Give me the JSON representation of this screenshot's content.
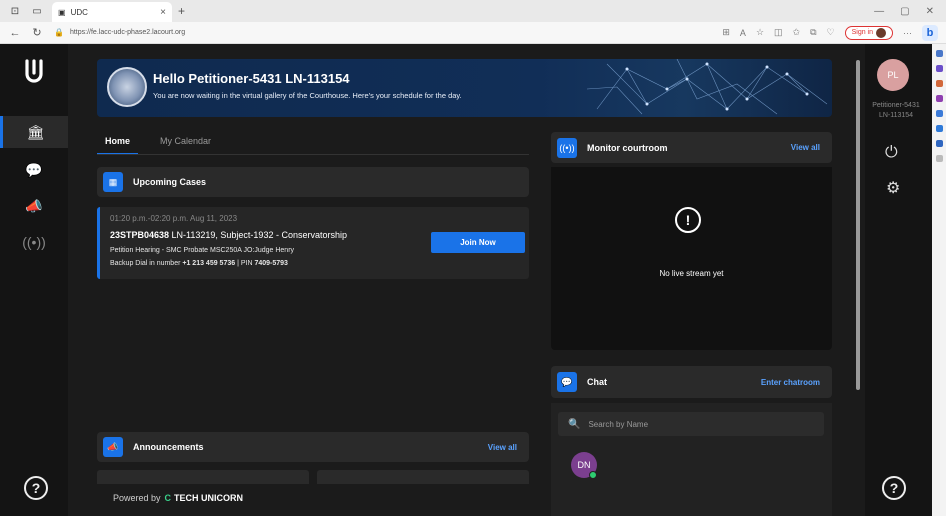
{
  "browser": {
    "tab_title": "UDC",
    "tab_close": "×",
    "new_tab": "+",
    "url": "https://fe.lacc-udc-phase2.lacourt.org",
    "signin_label": "Sign in",
    "edge_label": "b"
  },
  "sidebar": {
    "help_label": "?"
  },
  "banner": {
    "title": "Hello Petitioner-5431 LN-113154",
    "subtitle": "You are now waiting in the virtual gallery of the Courthouse. Here's your schedule for the day."
  },
  "tabs": {
    "home": "Home",
    "calendar": "My Calendar"
  },
  "upcoming": {
    "title": "Upcoming Cases",
    "case": {
      "time": "01:20 p.m.-02:20 p.m. Aug 11, 2023",
      "case_number": "23STPB04638",
      "case_rest": " LN-113219, Subject-1932 - Conservatorship",
      "line1": "Petition Hearing - SMC Probate MSC250A JO:Judge Henry",
      "backup_prefix": "Backup Dial in number ",
      "backup_number": "+1 213 459 5736",
      "pin_prefix": " | PIN ",
      "pin": "7409-5793",
      "join_label": "Join Now"
    }
  },
  "announcements": {
    "title": "Announcements",
    "view_all": "View all"
  },
  "footer": {
    "powered_by": "Powered by",
    "brand": "TECH UNICORN"
  },
  "monitor": {
    "title": "Monitor courtroom",
    "view_all": "View all",
    "empty": "No live stream yet"
  },
  "chat": {
    "title": "Chat",
    "enter": "Enter chatroom",
    "search_placeholder": "Search by Name",
    "user_initials": "DN"
  },
  "user": {
    "initials": "PL",
    "name": "Petitioner-5431 LN-113154"
  },
  "colors": {
    "accent": "#1a73e8",
    "link": "#5aa2ff",
    "online": "#2ecc71"
  }
}
